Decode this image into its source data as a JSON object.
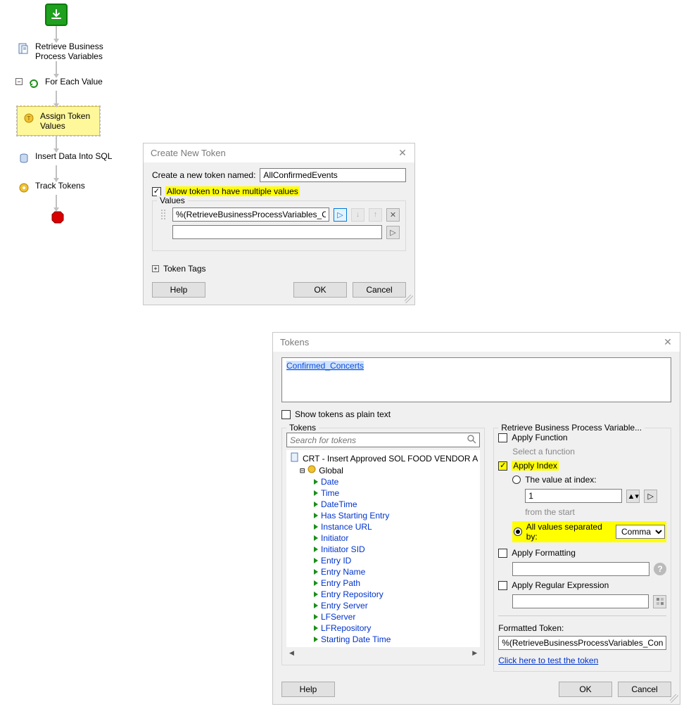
{
  "workflow": {
    "steps": [
      {
        "label": "Retrieve Business Process Variables"
      },
      {
        "label": "For Each Value"
      },
      {
        "label": "Assign Token Values"
      },
      {
        "label": "Insert Data Into SQL"
      },
      {
        "label": "Track Tokens"
      }
    ]
  },
  "dialog_create": {
    "title": "Create New Token",
    "name_label": "Create a new token named:",
    "name_value": "AllConfirmedEvents",
    "allow_multi_label": "Allow token to have multiple values",
    "values_legend": "Values",
    "value_row": "%(RetrieveBusinessProcessVariables_Confirmed_Con",
    "token_tags_label": "Token Tags",
    "help": "Help",
    "ok": "OK",
    "cancel": "Cancel"
  },
  "dialog_tokens": {
    "title": "Tokens",
    "preview_link": "Confirmed_Concerts",
    "plain_text_label": "Show tokens as plain text",
    "tokens_legend": "Tokens",
    "search_placeholder": "Search for tokens",
    "tree_root": "CRT - Insert Approved SOL FOOD VENDOR A",
    "tree_global": "Global",
    "tree_items": [
      "Date",
      "Time",
      "DateTime",
      "Has Starting Entry",
      "Instance URL",
      "Initiator",
      "Initiator SID",
      "Entry ID",
      "Entry Name",
      "Entry Path",
      "Entry Repository",
      "Entry Server",
      "LFServer",
      "LFRepository",
      "Starting Date Time"
    ],
    "tree_last_overflow": "Starting DateTime",
    "right_legend": "Retrieve Business Process Variable...",
    "apply_function_label": "Apply Function",
    "select_function_hint": "Select a function",
    "apply_index_label": "Apply Index",
    "value_at_index_label": "The value at index:",
    "index_value": "1",
    "from_the_start": "from the   start",
    "all_values_sep_label": "All values separated by:",
    "separator_option": "Comma",
    "apply_formatting_label": "Apply Formatting",
    "apply_regex_label": "Apply Regular Expression",
    "formatted_label": "Formatted Token:",
    "formatted_value": "%(RetrieveBusinessProcessVariables_Confirmed_Conc",
    "test_link": "Click here to test the token",
    "help": "Help",
    "ok": "OK",
    "cancel": "Cancel"
  }
}
